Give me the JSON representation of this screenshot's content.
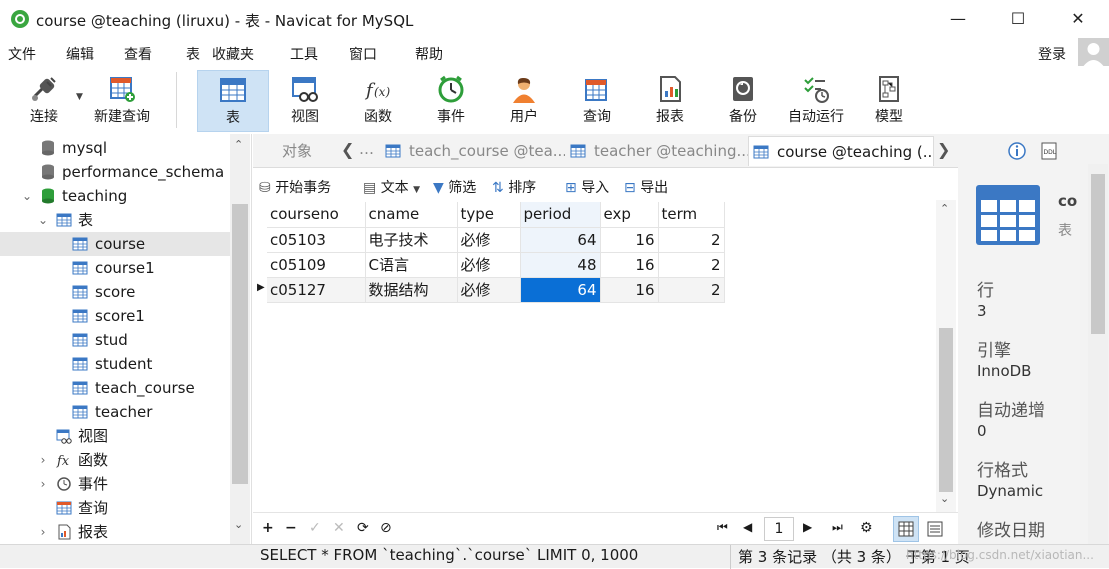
{
  "window": {
    "title": "course @teaching (liruxu) - 表 - Navicat for MySQL",
    "minimize": "—",
    "maximize": "☐",
    "close": "✕"
  },
  "menu": {
    "items": [
      "文件",
      "编辑",
      "查看",
      "表",
      "收藏夹",
      "工具",
      "窗口",
      "帮助"
    ],
    "login": "登录"
  },
  "toolbar": {
    "connect": "连接",
    "new_query": "新建查询",
    "table": "表",
    "view": "视图",
    "function": "函数",
    "event": "事件",
    "user": "用户",
    "query": "查询",
    "report": "报表",
    "backup": "备份",
    "schedule": "自动运行",
    "model": "模型"
  },
  "tree": {
    "items": [
      "mysql",
      "performance_schema",
      "teaching",
      "表",
      "course",
      "course1",
      "score",
      "score1",
      "stud",
      "student",
      "teach_course",
      "teacher",
      "视图",
      "函数",
      "事件",
      "查询",
      "报表"
    ]
  },
  "tabs": {
    "objects": "对象",
    "tab1": "teach_course @tea...",
    "tab2": "teacher @teaching...",
    "tab3": "course @teaching (..."
  },
  "subtoolbar": {
    "begin_tx": "开始事务",
    "text": "文本",
    "filter": "筛选",
    "sort": "排序",
    "import": "导入",
    "export": "导出"
  },
  "grid": {
    "columns": [
      "courseno",
      "cname",
      "type",
      "period",
      "exp",
      "term"
    ],
    "rows": [
      [
        "c05103",
        "电子技术",
        "必修",
        "64",
        "16",
        "2"
      ],
      [
        "c05109",
        "C语言",
        "必修",
        "48",
        "16",
        "2"
      ],
      [
        "c05127",
        "数据结构",
        "必修",
        "64",
        "16",
        "2"
      ]
    ],
    "selected_row": 2,
    "selected_col": 3
  },
  "bottom": {
    "add": "+",
    "remove": "−",
    "apply": "✓",
    "cancel": "✕",
    "refresh": "⟳",
    "stop": "⊘",
    "page": "1",
    "first": "⏮",
    "prev": "◀",
    "next": "▶",
    "last": "⏭",
    "settings": "⚙"
  },
  "status": {
    "sql": "SELECT * FROM `teaching`.`course` LIMIT 0, 1000",
    "record": "第 3 条记录 （共 3 条） 于第 1 页",
    "watermark": "https://blog.csdn.net/xiaotian..."
  },
  "info": {
    "name": "co",
    "kind": "表",
    "rows_label": "行",
    "rows_value": "3",
    "engine_label": "引擎",
    "engine_value": "InnoDB",
    "autoinc_label": "自动递增",
    "autoinc_value": "0",
    "rowformat_label": "行格式",
    "rowformat_value": "Dynamic",
    "modified_label": "修改日期"
  },
  "colors": {
    "accent": "#0a6fd6",
    "toolbar_active": "#cfe3f5",
    "db_green": "#2e9e3a"
  }
}
